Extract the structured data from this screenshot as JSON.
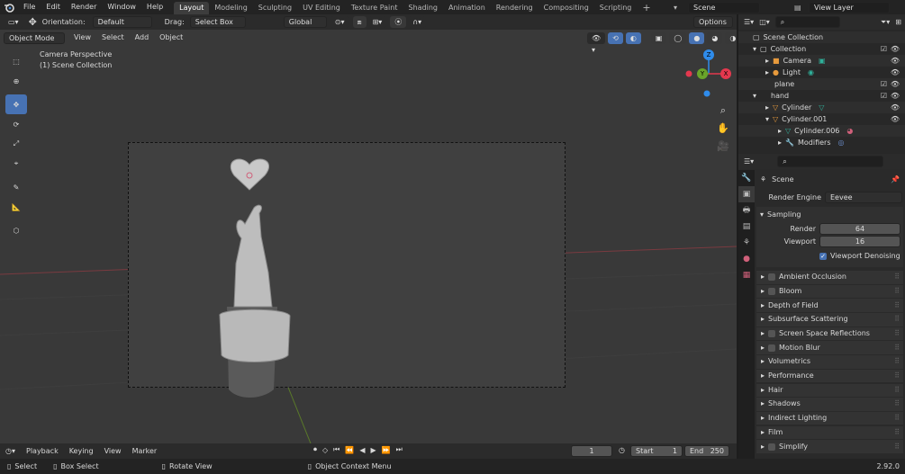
{
  "topbar": {
    "menus": [
      "File",
      "Edit",
      "Render",
      "Window",
      "Help"
    ],
    "workspaces": [
      "Layout",
      "Modeling",
      "Sculpting",
      "UV Editing",
      "Texture Paint",
      "Shading",
      "Animation",
      "Rendering",
      "Compositing",
      "Scripting"
    ],
    "scene": "Scene",
    "view_layer": "View Layer"
  },
  "toolheader": {
    "orientation_label": "Orientation:",
    "orientation_value": "Default",
    "drag_label": "Drag:",
    "drag_value": "Select Box",
    "transform": "Global",
    "options": "Options"
  },
  "vpheader": {
    "mode": "Object Mode",
    "menus": [
      "View",
      "Select",
      "Add",
      "Object"
    ]
  },
  "viewport": {
    "info_line1": "Camera Perspective",
    "info_line2": "(1) Scene Collection",
    "gizmo": {
      "x": "X",
      "y": "Y",
      "z": "Z"
    }
  },
  "outliner": {
    "rows": [
      "Scene Collection",
      "Collection",
      "Camera",
      "Light",
      "plane",
      "hand",
      "Cylinder",
      "Cylinder.001",
      "Cylinder.006",
      "Modifiers"
    ]
  },
  "properties": {
    "scene": "Scene",
    "render_engine_label": "Render Engine",
    "render_engine": "Eevee",
    "sampling": "Sampling",
    "render_label": "Render",
    "render_value": "64",
    "viewport_label": "Viewport",
    "viewport_value": "16",
    "denoise": "Viewport Denoising",
    "panels": [
      "Ambient Occlusion",
      "Bloom",
      "Depth of Field",
      "Subsurface Scattering",
      "Screen Space Reflections",
      "Motion Blur",
      "Volumetrics",
      "Performance",
      "Hair",
      "Shadows",
      "Indirect Lighting",
      "Film",
      "Simplify"
    ]
  },
  "timeline": {
    "playback": "Playback",
    "keying": "Keying",
    "view": "View",
    "marker": "Marker",
    "current": "1",
    "start_label": "Start",
    "start": "1",
    "end_label": "End",
    "end": "250"
  },
  "status": {
    "select": "Select",
    "box": "Box Select",
    "rotate": "Rotate View",
    "context": "Object Context Menu",
    "version": "2.92.0"
  },
  "colors": {
    "accent": "#4772b3",
    "x_axis": "#e4384e",
    "y_axis": "#6aa42a",
    "z_axis": "#2f8ceb",
    "object_orange": "#e79a3c",
    "mesh_green": "#2fb09a"
  }
}
